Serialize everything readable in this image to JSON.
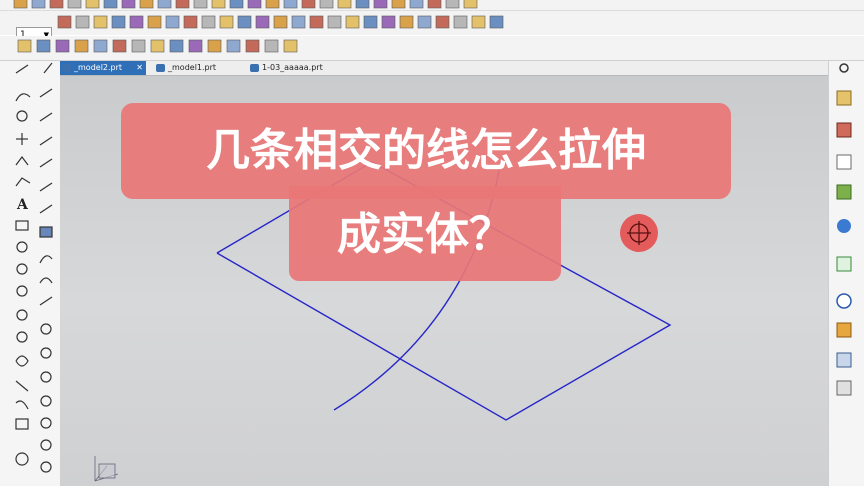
{
  "toolbar": {
    "layer_combo_value": "1"
  },
  "tabs": [
    {
      "label": "_model2.prt",
      "active": true
    },
    {
      "label": "_model1.prt",
      "active": false
    },
    {
      "label": "1-03_aaaaa.prt",
      "active": false
    }
  ],
  "overlay": {
    "line1": "几条相交的线怎么拉伸",
    "line2": "成实体？"
  },
  "colors": {
    "curve": "#2222cc",
    "banner": "#e87676",
    "active_tab": "#2f6fb7"
  }
}
